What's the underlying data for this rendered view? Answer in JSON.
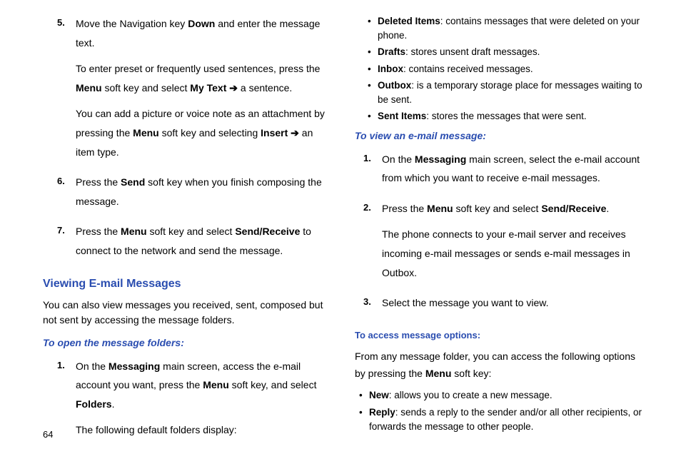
{
  "col1": {
    "step5": {
      "num": "5.",
      "p1a": "Move the Navigation key ",
      "p1b": "Down",
      "p1c": " and enter the message text.",
      "p2a": "To enter preset or frequently used sentences, press the ",
      "p2b": "Menu",
      "p2c": " soft key and select ",
      "p2d": "My Text",
      "p2e": " a sentence.",
      "p3a": "You can add a picture or voice note as an attachment by pressing the ",
      "p3b": "Menu",
      "p3c": " soft key and selecting ",
      "p3d": "Insert",
      "p3e": " an item type."
    },
    "step6": {
      "num": "6.",
      "p1a": "Press the ",
      "p1b": "Send",
      "p1c": " soft key when you finish composing the message."
    },
    "step7": {
      "num": "7.",
      "p1a": "Press the ",
      "p1b": "Menu",
      "p1c": " soft key and select ",
      "p1d": "Send/Receive",
      "p1e": " to connect to the network and send the message."
    },
    "h2": "Viewing E-mail Messages",
    "intro": "You can also view messages you received, sent, composed but not sent by accessing the message folders.",
    "h3": "To open the message folders:",
    "open1": {
      "num": "1.",
      "p1a": "On the ",
      "p1b": "Messaging",
      "p1c": " main screen, access the e-mail account you want, press the ",
      "p1d": "Menu",
      "p1e": " soft key, and select ",
      "p1f": "Folders",
      "p1g": ".",
      "p2": "The following default folders display:"
    }
  },
  "col2": {
    "b1": {
      "t": "Deleted Items",
      "r": ": contains messages that were deleted on your phone."
    },
    "b2": {
      "t": "Drafts",
      "r": ": stores unsent draft messages."
    },
    "b3": {
      "t": "Inbox",
      "r": ": contains received messages."
    },
    "b4": {
      "t": "Outbox",
      "r": ": is a temporary storage place for messages waiting to be sent."
    },
    "b5": {
      "t": "Sent Items",
      "r": ": stores the messages that were sent."
    },
    "h3": "To view an e-mail message:",
    "view1": {
      "num": "1.",
      "p1a": "On the ",
      "p1b": "Messaging",
      "p1c": " main screen, select the e-mail account from which you want to receive e-mail messages."
    },
    "view2": {
      "num": "2.",
      "p1a": "Press the ",
      "p1b": "Menu",
      "p1c": " soft key and select ",
      "p1d": "Send/Receive",
      "p1e": ".",
      "p2": "The phone connects to your e-mail server and receives incoming e-mail messages or sends e-mail messages in Outbox."
    },
    "view3": {
      "num": "3.",
      "p1": "Select the message you want to view."
    },
    "h4": "To access message options:",
    "opt_intro_a": "From any message folder, you can access the following options by pressing the ",
    "opt_intro_b": "Menu",
    "opt_intro_c": " soft key:",
    "ob1": {
      "t": "New",
      "r": ": allows you to create a new message."
    },
    "ob2": {
      "t": "Reply",
      "r": ": sends a reply to the sender and/or all other recipients, or forwards the message to other people."
    }
  },
  "arrow": "➔",
  "pageNum": "64"
}
